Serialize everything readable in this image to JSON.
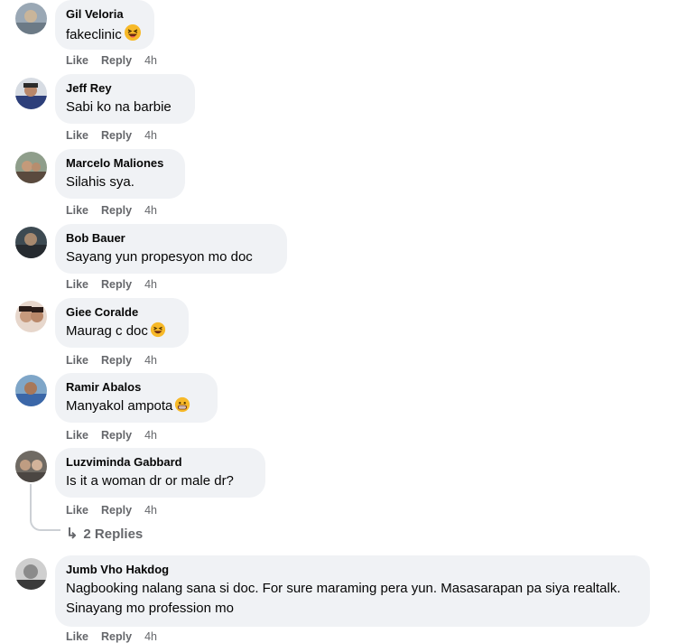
{
  "actions": {
    "like": "Like",
    "reply": "Reply"
  },
  "comments": [
    {
      "name": "Gil Veloria",
      "text": "fakeclinic",
      "time": "4h",
      "emoji": "laughing-emoji"
    },
    {
      "name": "Jeff Rey",
      "text": "Sabi ko na barbie",
      "time": "4h"
    },
    {
      "name": "Marcelo Maliones",
      "text": "Silahis sya.",
      "time": "4h"
    },
    {
      "name": "Bob Bauer",
      "text": "Sayang yun propesyon mo doc",
      "time": "4h"
    },
    {
      "name": "Giee Coralde",
      "text": "Maurag c doc",
      "time": "4h",
      "emoji": "laughing-emoji"
    },
    {
      "name": "Ramir Abalos",
      "text": "Manyakol ampota",
      "time": "4h",
      "emoji": "grin-emoji"
    },
    {
      "name": "Luzviminda Gabbard",
      "text": "Is it a woman dr or male dr?",
      "time": "4h"
    },
    {
      "name": "Jumb Vho Hakdog",
      "text": "Nagbooking nalang sana si doc. For sure maraming pera yun. Masasarapan pa siya realtalk. Sinayang mo profession mo",
      "time": "4h"
    }
  ],
  "replies_link": {
    "icon": "reply-arrow-icon",
    "label": "2 Replies"
  },
  "colors": {
    "bubble": "#f0f2f5",
    "meta_text": "#65676b",
    "name_text": "#050505"
  }
}
